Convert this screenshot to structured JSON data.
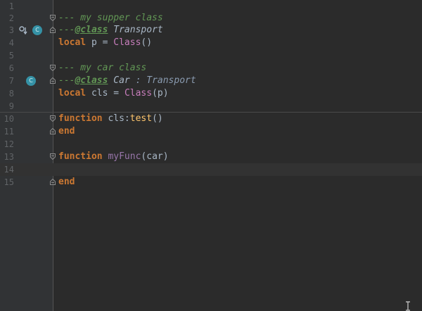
{
  "editor": {
    "lines": [
      {
        "num": "1"
      },
      {
        "num": "2",
        "comment": "--- my supper class"
      },
      {
        "num": "3",
        "prefix": "---",
        "tag": "@class",
        "sp": " ",
        "type": "Transport"
      },
      {
        "num": "4",
        "kw": "local",
        "rest_a": " p = ",
        "cls": "Class",
        "rest_b": "()"
      },
      {
        "num": "5"
      },
      {
        "num": "6",
        "comment": "--- my car class"
      },
      {
        "num": "7",
        "prefix": "---",
        "tag": "@class",
        "sp": " ",
        "type": "Car",
        "parent": " : Transport"
      },
      {
        "num": "8",
        "kw": "local",
        "rest_a": " cls = ",
        "cls": "Class",
        "rest_b": "(p)"
      },
      {
        "num": "9"
      },
      {
        "num": "10",
        "kw": "function",
        "rest_a": " cls:",
        "func": "test",
        "rest_b": "()"
      },
      {
        "num": "11",
        "kw": "end"
      },
      {
        "num": "12"
      },
      {
        "num": "13",
        "kw": "function",
        "sp": " ",
        "global": "myFunc",
        "rest_b": "(car)"
      },
      {
        "num": "14"
      },
      {
        "num": "15",
        "kw": "end"
      }
    ],
    "badges": {
      "class_marker": "C"
    },
    "colors": {
      "background": "#2b2b2b",
      "gutter": "#313335",
      "keyword": "#cc7832",
      "comment": "#629755",
      "badge": "#3592a6"
    }
  }
}
